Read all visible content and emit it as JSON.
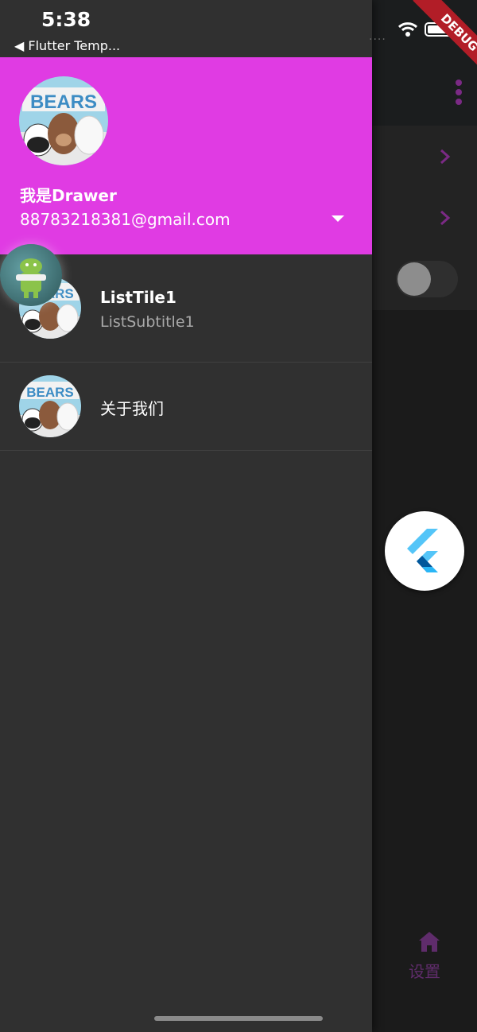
{
  "status_bar": {
    "time": "5:38",
    "back_app": "◀ Flutter Temp...",
    "signal": "....",
    "debug_label": "DEBUG"
  },
  "drawer": {
    "header": {
      "name": "我是Drawer",
      "email": "88783218381@gmail.com",
      "avatar_icon": "we-bare-bears-avatar",
      "dropdown_icon": "triangle-down-icon"
    },
    "items": [
      {
        "title": "ListTile1",
        "subtitle": "ListSubtitle1",
        "avatar_icon": "we-bare-bears-avatar"
      },
      {
        "title": "关于我们",
        "subtitle": "",
        "avatar_icon": "we-bare-bears-avatar"
      }
    ]
  },
  "background_app": {
    "bottom_nav": {
      "label": "设置",
      "icon": "home-icon"
    },
    "fab_icon": "flutter-logo-icon",
    "switch_on": false
  },
  "colors": {
    "drawer_header": "#e03be3",
    "drawer_body": "#303030",
    "accent": "#7b2a85"
  }
}
